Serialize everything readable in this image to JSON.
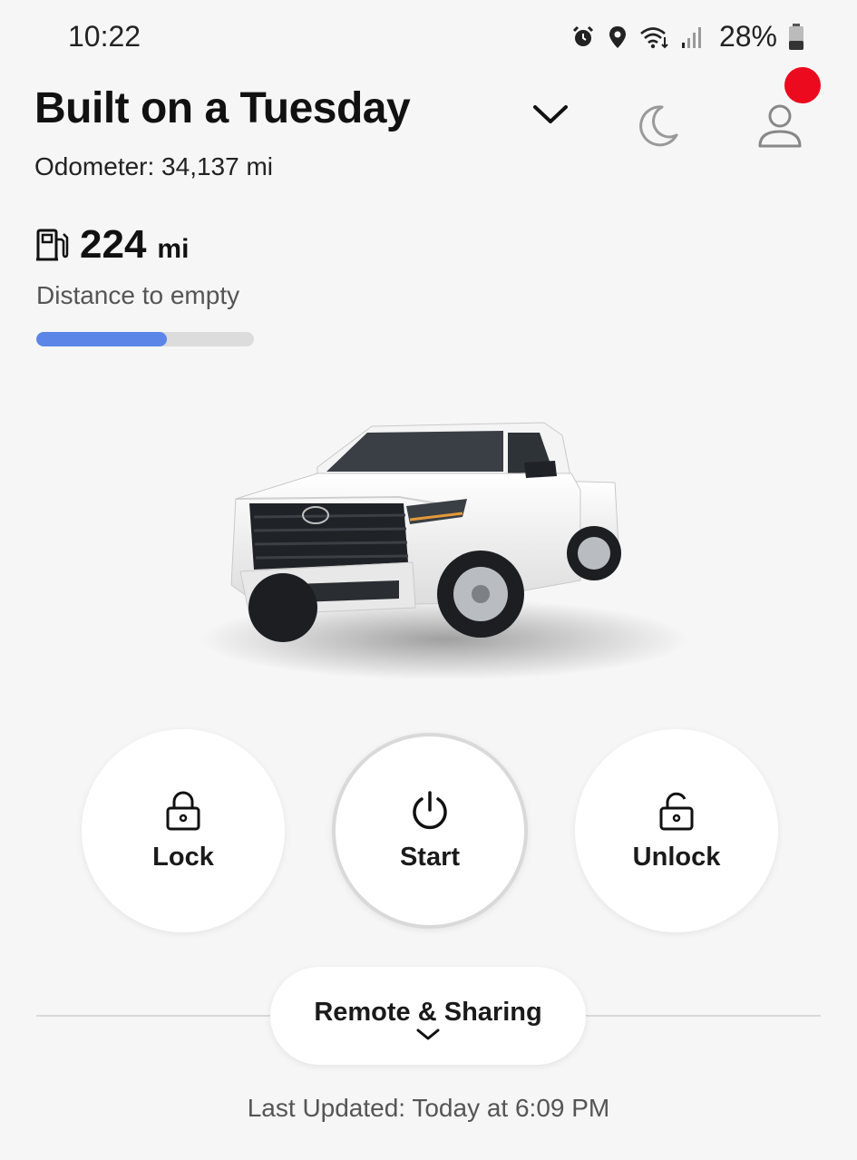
{
  "status_bar": {
    "time": "10:22",
    "battery": "28%",
    "icons": [
      "alarm-icon",
      "location-icon",
      "wifi-icon",
      "signal-icon",
      "battery-icon"
    ]
  },
  "header": {
    "vehicle_name": "Built on a Tuesday",
    "odometer": "Odometer: 34,137 mi",
    "icons": [
      "chevron-down-icon",
      "moon-icon",
      "profile-icon"
    ],
    "notification_color": "#eb0a1e"
  },
  "fuel": {
    "value": "224",
    "unit": "mi",
    "label": "Distance to empty",
    "level_fraction": 0.6,
    "bar_color": "#5b86e8"
  },
  "actions": [
    {
      "label": "Lock",
      "icon": "lock-icon"
    },
    {
      "label": "Start",
      "icon": "power-icon"
    },
    {
      "label": "Unlock",
      "icon": "unlock-icon"
    }
  ],
  "remote": {
    "label": "Remote & Sharing",
    "icon": "chevron-down-icon"
  },
  "footer": {
    "last_updated": "Last Updated: Today at 6:09 PM"
  }
}
